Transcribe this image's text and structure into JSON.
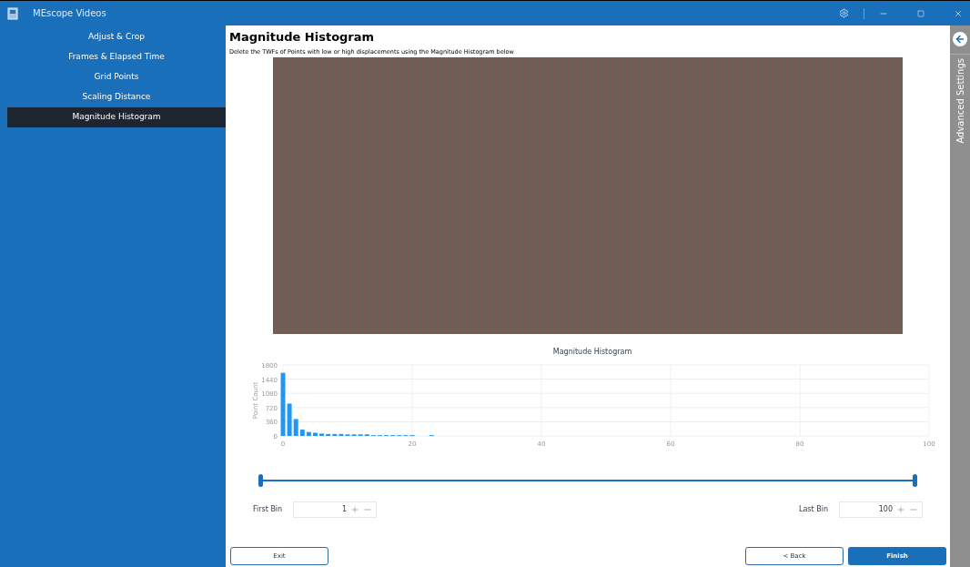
{
  "window": {
    "title": "MEscope Videos"
  },
  "sidebar": {
    "items": [
      {
        "label": "Adjust & Crop",
        "selected": false
      },
      {
        "label": "Frames & Elapsed Time",
        "selected": false
      },
      {
        "label": "Grid Points",
        "selected": false
      },
      {
        "label": "Scaling Distance",
        "selected": false
      },
      {
        "label": "Magnitude Histogram",
        "selected": true
      }
    ]
  },
  "main": {
    "heading": "Magnitude Histogram",
    "instruction": "Delete the TWFs of Points with low or high displacements using the Magnitude Histogram below",
    "chart_data": {
      "type": "bar",
      "title": "Magnitude Histogram",
      "ylabel": "Point Count",
      "x": [
        0,
        1,
        2,
        3,
        4,
        5,
        6,
        7,
        8,
        9,
        10,
        11,
        12,
        13,
        14,
        15,
        16,
        17,
        18,
        19,
        20,
        23
      ],
      "values": [
        1600,
        820,
        430,
        160,
        100,
        80,
        60,
        50,
        50,
        50,
        40,
        40,
        40,
        40,
        20,
        20,
        20,
        20,
        20,
        20,
        20,
        20
      ],
      "grid": true,
      "xlim": [
        0,
        100
      ],
      "ylim": [
        0,
        1800
      ],
      "xticks": [
        0,
        20,
        40,
        60,
        80,
        100
      ],
      "yticks": [
        0,
        360,
        720,
        1080,
        1440,
        1800
      ]
    },
    "range_slider": {
      "low": {
        "level": 0
      },
      "high": {
        "level": 1
      }
    },
    "first_bin": {
      "label": "First Bin",
      "value": "1"
    },
    "last_bin": {
      "label": "Last Bin",
      "value": "100"
    },
    "buttons": {
      "exit": "Exit",
      "back": "< Back",
      "finish": "Finish"
    }
  },
  "side_panel": {
    "label": "Advanced Settings"
  }
}
